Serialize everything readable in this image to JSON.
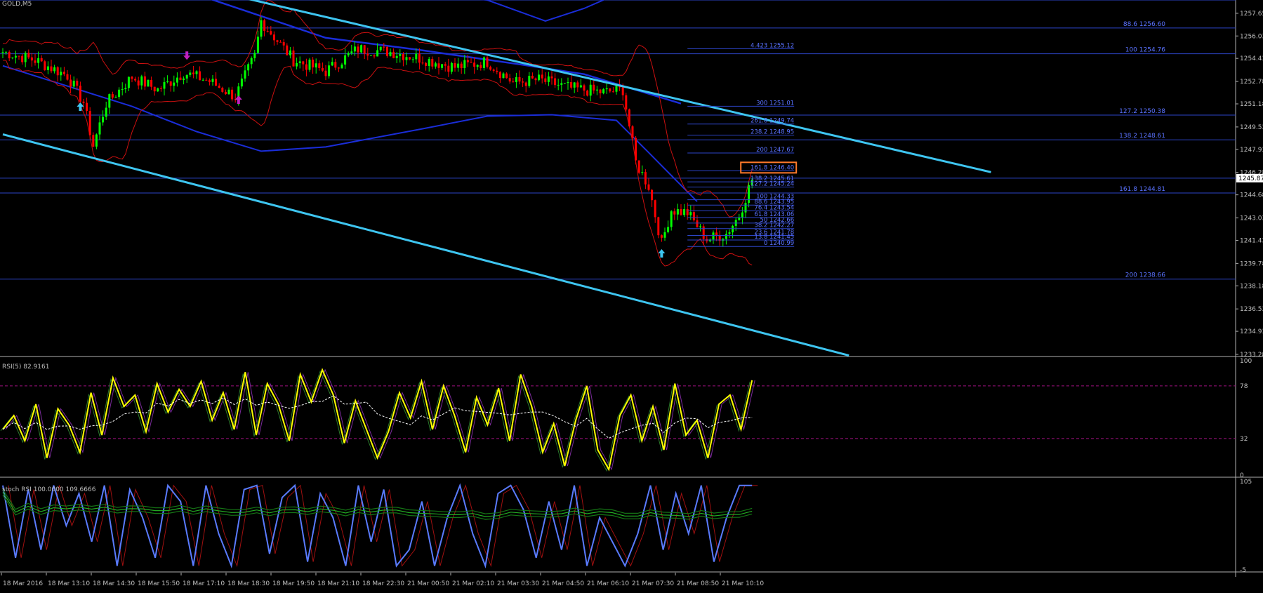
{
  "panels": {
    "main": {
      "title": "GOLD,M5"
    },
    "rsi": {
      "title": "RSI(5) 82.9161"
    },
    "stoch": {
      "title": "stoch RSI 100.0000 109.6666"
    }
  },
  "colors": {
    "background": "#000000",
    "bull_candle": "#00ff00",
    "bear_candle": "#ff0000",
    "channel_line": "#3ec5f0",
    "level_line": "#2d45c8",
    "bollinger": "#cc1010",
    "moving_average": "#1a2dd8",
    "rsi_line": "#ffff00",
    "stoch_line": "#5a7bff",
    "fib_label": "#5a72ff",
    "highlight_box": "#ff7a2a",
    "current_price_box": "#ffffff"
  },
  "chart_data": [
    {
      "type": "candlestick",
      "symbol": "GOLD",
      "timeframe": "M5",
      "title": "GOLD,M5",
      "ylim": [
        1233.28,
        1258.6
      ],
      "y_ticks": [
        1257.65,
        1256.03,
        1254.43,
        1252.78,
        1251.18,
        1249.53,
        1247.93,
        1246.28,
        1244.68,
        1243.03,
        1241.43,
        1239.78,
        1238.18,
        1236.53,
        1234.93,
        1233.28
      ],
      "current_price": 1245.87,
      "x_tick_labels": [
        "18 Mar 2016",
        "18 Mar 13:10",
        "18 Mar 14:30",
        "18 Mar 15:50",
        "18 Mar 17:10",
        "18 Mar 18:30",
        "18 Mar 19:50",
        "18 Mar 21:10",
        "18 Mar 22:30",
        "21 Mar 00:50",
        "21 Mar 02:10",
        "21 Mar 03:30",
        "21 Mar 04:50",
        "21 Mar 06:10",
        "21 Mar 07:30",
        "21 Mar 08:50",
        "21 Mar 10:10"
      ],
      "close_path": [
        [
          0,
          1254.9
        ],
        [
          10,
          1254.3
        ],
        [
          20,
          1253.2
        ],
        [
          25,
          1251.3
        ],
        [
          28,
          1248.2
        ],
        [
          32,
          1251.2
        ],
        [
          40,
          1253.1
        ],
        [
          48,
          1252.2
        ],
        [
          56,
          1253.4
        ],
        [
          64,
          1252.8
        ],
        [
          72,
          1251.7
        ],
        [
          78,
          1254.6
        ],
        [
          80,
          1257.1
        ],
        [
          90,
          1254.3
        ],
        [
          100,
          1253.5
        ],
        [
          110,
          1255.1
        ],
        [
          120,
          1254.9
        ],
        [
          130,
          1254.4
        ],
        [
          140,
          1253.8
        ],
        [
          150,
          1254.2
        ],
        [
          158,
          1252.7
        ],
        [
          166,
          1252.9
        ],
        [
          176,
          1252.3
        ],
        [
          186,
          1252.0
        ],
        [
          192,
          1252.2
        ],
        [
          196,
          1247.0
        ],
        [
          200,
          1245.3
        ],
        [
          204,
          1241.2
        ],
        [
          207,
          1243.6
        ],
        [
          212,
          1243.4
        ],
        [
          218,
          1241.5
        ],
        [
          224,
          1241.9
        ],
        [
          228,
          1243.2
        ],
        [
          232,
          1245.8
        ]
      ],
      "arrows": [
        {
          "x": 24,
          "direction": "up",
          "color": "#3ec5f0"
        },
        {
          "x": 57,
          "direction": "down",
          "color": "#c020c0"
        },
        {
          "x": 73,
          "direction": "up",
          "color": "#c020c0"
        },
        {
          "x": 204,
          "direction": "up",
          "color": "#3ec5f0"
        }
      ],
      "horizontal_levels": [
        {
          "price": 1258.6,
          "label": ""
        },
        {
          "price": 1256.6,
          "label": "88.6 1256.60"
        },
        {
          "price": 1254.76,
          "label": "100 1254.76"
        },
        {
          "price": 1250.38,
          "label": "127.2 1250.38"
        },
        {
          "price": 1248.61,
          "label": "138.2 1248.61"
        },
        {
          "price": 1245.87,
          "label": ""
        },
        {
          "price": 1244.81,
          "label": "161.8 1244.81"
        },
        {
          "price": 1238.66,
          "label": "200 1238.66"
        }
      ],
      "fib_extension": [
        {
          "label": "4.423 1255.12",
          "price": 1255.12
        },
        {
          "label": "300 1251.01",
          "price": 1251.01
        },
        {
          "label": "261.8 1249.74",
          "price": 1249.74
        },
        {
          "label": "238.2 1248.95",
          "price": 1248.95
        },
        {
          "label": "200 1247.67",
          "price": 1247.67
        },
        {
          "label": "161.8 1246.40",
          "price": 1246.4,
          "highlighted": true
        },
        {
          "label": "138.2 1245.61",
          "price": 1245.61
        },
        {
          "label": "127.2 1245.24",
          "price": 1245.24
        },
        {
          "label": "100 1244.33",
          "price": 1244.33
        },
        {
          "label": "88.6 1243.95",
          "price": 1243.95
        },
        {
          "label": "76.4 1243.54",
          "price": 1243.54
        },
        {
          "label": "61.8 1243.06",
          "price": 1243.06
        },
        {
          "label": "50 1242.66",
          "price": 1242.66
        },
        {
          "label": "38.2 1242.27",
          "price": 1242.27
        },
        {
          "label": "23.6 1241.78",
          "price": 1241.78
        },
        {
          "label": "13.8 1241.45",
          "price": 1241.45
        },
        {
          "label": "0 1240.99",
          "price": 1240.99
        }
      ],
      "channel_lines": [
        {
          "from": [
            0,
            1249.0
          ],
          "to": [
            262,
            1233.2
          ]
        },
        {
          "from": [
            70,
            1259.0
          ],
          "to": [
            306,
            1246.3
          ]
        }
      ],
      "moving_average_band": [
        [
          0,
          1253.9
        ],
        [
          40,
          1251.0
        ],
        [
          60,
          1249.2
        ],
        [
          80,
          1247.8
        ],
        [
          100,
          1248.1
        ],
        [
          130,
          1249.4
        ],
        [
          150,
          1250.3
        ],
        [
          170,
          1250.4
        ],
        [
          190,
          1250.0
        ],
        [
          200,
          1247.7
        ],
        [
          215,
          1244.2
        ]
      ],
      "moving_average_upper": [
        [
          60,
          1259.0
        ],
        [
          100,
          1255.9
        ],
        [
          130,
          1255.0
        ],
        [
          160,
          1254.0
        ],
        [
          180,
          1253.3
        ],
        [
          210,
          1251.2
        ]
      ],
      "moving_average_top": [
        [
          132,
          1259.0
        ],
        [
          150,
          1258.6
        ],
        [
          168,
          1257.1
        ],
        [
          180,
          1258.0
        ],
        [
          186,
          1258.6
        ]
      ]
    },
    {
      "type": "line",
      "title": "RSI(5) 82.9161",
      "ylim": [
        0,
        100
      ],
      "y_ticks": [
        100,
        78,
        32,
        0
      ],
      "levels": [
        78,
        32
      ],
      "series": [
        {
          "values": [
            40,
            52,
            30,
            62,
            15,
            58,
            44,
            20,
            72,
            35,
            85,
            60,
            70,
            38,
            80,
            55,
            75,
            60,
            82,
            48,
            72,
            40,
            90,
            35,
            80,
            62,
            30,
            88,
            64,
            92,
            70,
            28,
            65,
            40,
            15,
            38,
            72,
            50,
            82,
            40,
            78,
            52,
            20,
            68,
            44,
            76,
            30,
            88,
            60,
            20,
            45,
            8,
            48,
            78,
            22,
            5,
            52,
            70,
            30,
            60,
            22,
            80,
            35,
            48,
            15,
            62,
            70,
            40,
            82.9
          ]
        }
      ]
    },
    {
      "type": "line",
      "title": "stoch RSI 100.0000 109.6666",
      "ylim": [
        -5,
        105
      ],
      "y_ticks": [
        105,
        -5
      ],
      "series": [
        {
          "values": [
            100,
            10,
            95,
            20,
            100,
            50,
            90,
            30,
            100,
            0,
            95,
            60,
            10,
            100,
            80,
            0,
            100,
            40,
            0,
            95,
            100,
            15,
            85,
            100,
            5,
            90,
            60,
            0,
            100,
            30,
            95,
            0,
            20,
            80,
            0,
            60,
            100,
            40,
            0,
            90,
            100,
            70,
            10,
            80,
            20,
            100,
            0,
            60,
            30,
            0,
            40,
            100,
            20,
            90,
            40,
            100,
            5,
            60,
            100,
            100
          ]
        }
      ]
    }
  ]
}
